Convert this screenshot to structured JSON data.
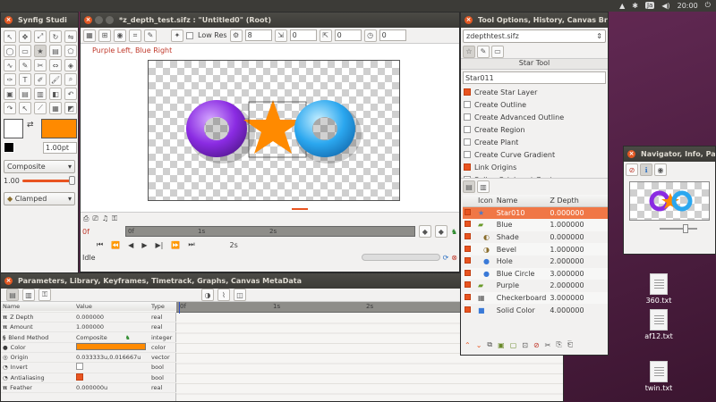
{
  "topbar": {
    "lang": "Ja",
    "time": "20:00"
  },
  "toolbox": {
    "title": "Synfig Studi",
    "blend_method": "Composite",
    "width_value": "1.00pt",
    "amount_value": "1.00",
    "interpolation": "Clamped",
    "colors": {
      "outline": "#ffffff",
      "fill": "#ff8a00"
    }
  },
  "canvas": {
    "title": "*z_depth_test.sifz : \"Untitled0\" (Root)",
    "low_res_label": "Low Res",
    "quality_value": "8",
    "x_value": "0",
    "y_value": "0",
    "zoom_value": "0",
    "render_label": "Purple Left, Blue Right",
    "time_start": "0f",
    "ruler_ticks": [
      "0f",
      "1s",
      "2s"
    ],
    "time_end": "2s",
    "status": "Idle"
  },
  "tool_options": {
    "title": "Tool Options, History, Canvas Bro",
    "file": "zdepthtest.sifz",
    "tool_name": "Star Tool",
    "layer_name": "Star011",
    "options": [
      {
        "label": "Create Star Layer",
        "checked": true
      },
      {
        "label": "Create Outline",
        "checked": false
      },
      {
        "label": "Create Advanced Outline",
        "checked": false
      },
      {
        "label": "Create Region",
        "checked": false
      },
      {
        "label": "Create Plant",
        "checked": false
      },
      {
        "label": "Create Curve Gradient",
        "checked": false
      },
      {
        "label": "Link Origins",
        "checked": true
      },
      {
        "label": "Spline Origins at Center",
        "checked": false
      }
    ]
  },
  "layers": {
    "headers": {
      "icon": "Icon",
      "name": "Name",
      "zdepth": "Z Depth"
    },
    "rows": [
      {
        "name": "Star010",
        "z": "0.000000",
        "selected": true,
        "icon": "star-icon",
        "indent": 0
      },
      {
        "name": "Blue",
        "z": "1.000000",
        "selected": false,
        "icon": "folder-icon",
        "indent": 0
      },
      {
        "name": "Shade",
        "z": "0.000000",
        "selected": false,
        "icon": "shade-icon",
        "indent": 1
      },
      {
        "name": "Bevel",
        "z": "1.000000",
        "selected": false,
        "icon": "bevel-icon",
        "indent": 1
      },
      {
        "name": "Hole",
        "z": "2.000000",
        "selected": false,
        "icon": "circle-icon",
        "indent": 1
      },
      {
        "name": "Blue Circle",
        "z": "3.000000",
        "selected": false,
        "icon": "circle-icon",
        "indent": 1
      },
      {
        "name": "Purple",
        "z": "2.000000",
        "selected": false,
        "icon": "folder-icon",
        "indent": 0
      },
      {
        "name": "Checkerboard",
        "z": "3.000000",
        "selected": false,
        "icon": "checkerboard-icon",
        "indent": 0
      },
      {
        "name": "Solid Color",
        "z": "4.000000",
        "selected": false,
        "icon": "solid-color-icon",
        "indent": 0
      }
    ]
  },
  "navigator": {
    "title": "Navigator, Info, Pa"
  },
  "params": {
    "title": "Parameters, Library, Keyframes, Timetrack, Graphs, Canvas MetaData",
    "headers": {
      "name": "Name",
      "value": "Value",
      "type": "Type"
    },
    "rows": [
      {
        "icon": "π",
        "name": "Z Depth",
        "value": "0.000000",
        "type": "real"
      },
      {
        "icon": "π",
        "name": "Amount",
        "value": "1.000000",
        "type": "real"
      },
      {
        "icon": "§",
        "name": "Blend Method",
        "value": "Composite",
        "type": "integer"
      },
      {
        "icon": "●",
        "name": "Color",
        "value": "",
        "type": "color"
      },
      {
        "icon": "◎",
        "name": "Origin",
        "value": "0.033333u,0.016667u",
        "type": "vector"
      },
      {
        "icon": "◔",
        "name": "Invert",
        "value": "",
        "type": "bool"
      },
      {
        "icon": "◔",
        "name": "Antialiasing",
        "value": "",
        "type": "bool"
      },
      {
        "icon": "π",
        "name": "Feather",
        "value": "0.000000u",
        "type": "real"
      }
    ],
    "timetrack_ticks": [
      "0f",
      "1s",
      "2s"
    ]
  },
  "desktop_icons": [
    "360.txt",
    "af12.txt",
    "twin.txt"
  ]
}
